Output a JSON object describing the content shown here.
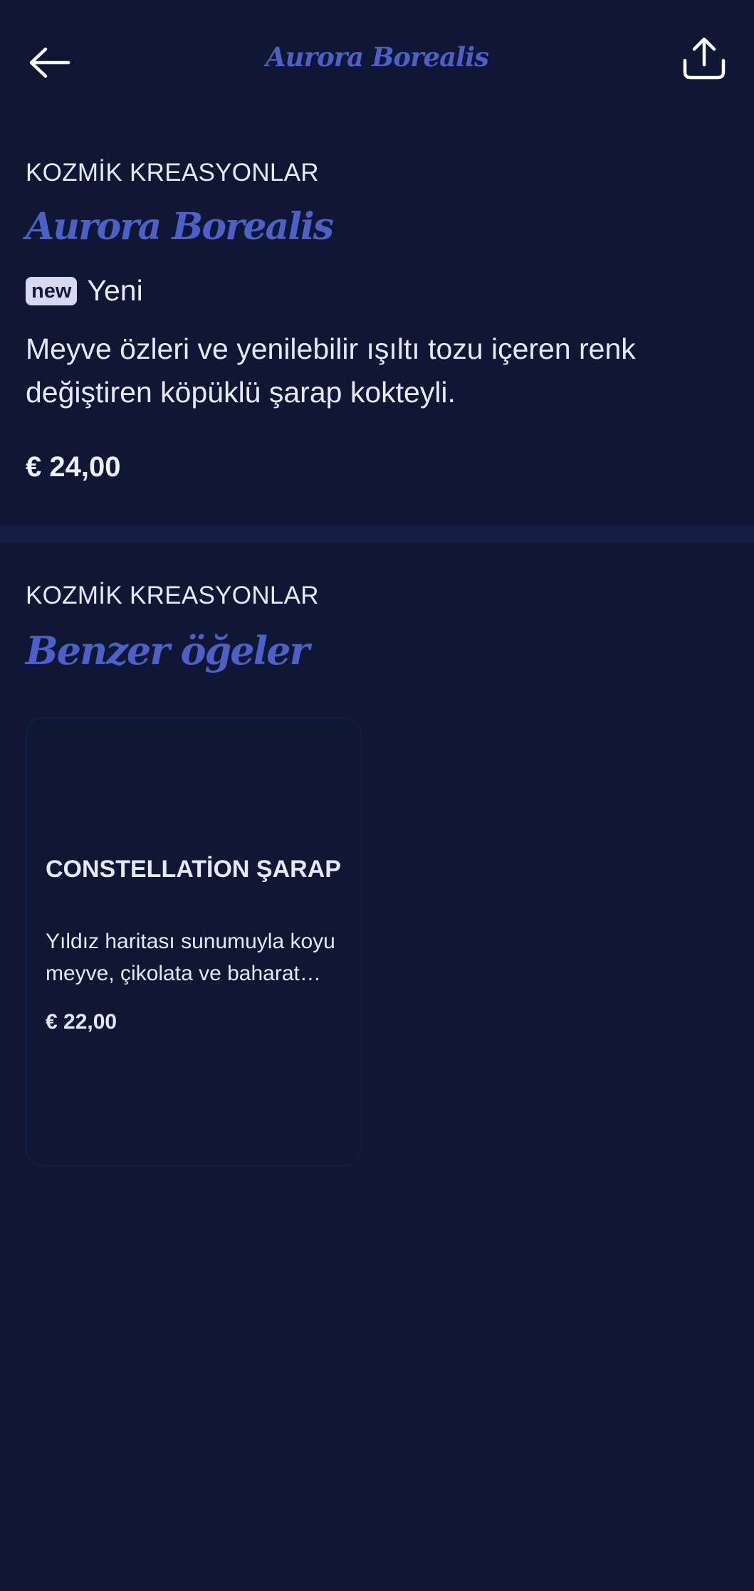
{
  "header": {
    "title": "Aurora Borealis",
    "back_icon": "arrow-left-icon",
    "share_icon": "share-icon"
  },
  "product": {
    "category": "KOZMİK KREASYONLAR",
    "name": "Aurora Borealis",
    "badge": "new",
    "badge_text": "Yeni",
    "description": "Meyve özleri ve yenilebilir ışıltı tozu içeren renk değiştiren köpüklü şarap kokteyli.",
    "price": "€ 24,00"
  },
  "similar": {
    "category": "KOZMİK KREASYONLAR",
    "title": "Benzer öğeler",
    "items": [
      {
        "name": "CONSTELLATİON ŞARAP",
        "description": "Yıldız haritası sunumuyla koyu meyve, çikolata ve baharat notaları",
        "price": "€ 22,00"
      }
    ]
  },
  "colors": {
    "background": "#0f1734",
    "accent": "#4d60c8",
    "divider": "#131d43",
    "text": "#e7eaf6",
    "badge_bg": "#d6d9ef"
  }
}
